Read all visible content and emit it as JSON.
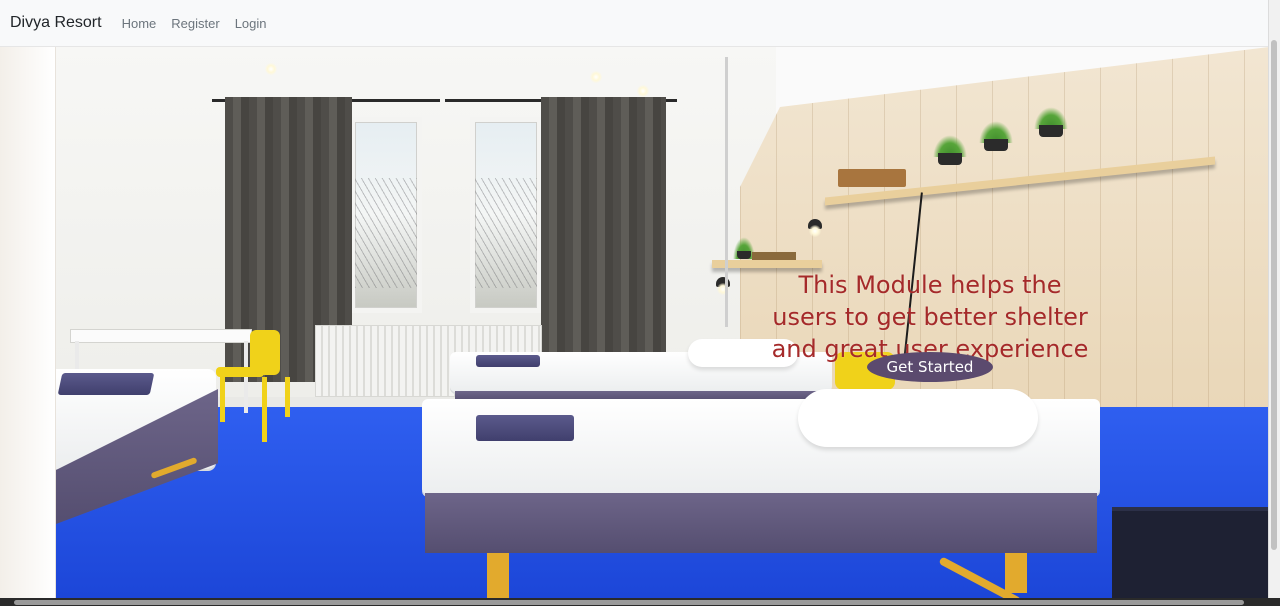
{
  "navbar": {
    "brand": "Divya Resort",
    "links": [
      "Home",
      "Register",
      "Login"
    ]
  },
  "hero": {
    "lines": [
      "This Module helps the",
      "users to get better shelter",
      "and great user experience"
    ],
    "cta_label": "Get Started"
  },
  "colors": {
    "headline": "#a52a2a",
    "cta_background": "#5b4a6e",
    "navbar_background": "#f8f9fa",
    "floor": "#2450e6"
  }
}
